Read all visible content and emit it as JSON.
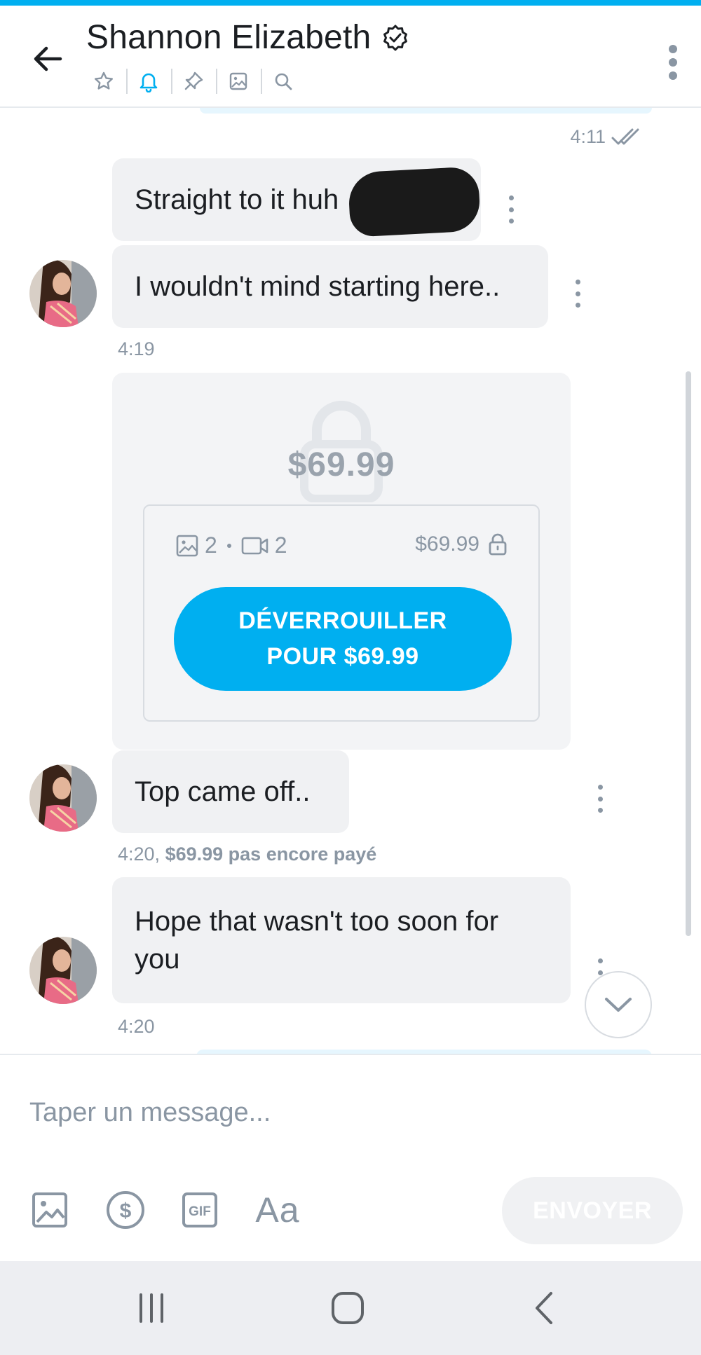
{
  "header": {
    "back_icon": "arrow-left-icon",
    "title": "Shannon Elizabeth",
    "verified_icon": "verified-badge-icon",
    "icons": [
      "star-icon",
      "bell-icon",
      "pin-icon",
      "gallery-icon",
      "search-icon"
    ],
    "active_icon": "bell-icon",
    "more_icon": "more-vertical-icon"
  },
  "messages": {
    "sent_time": "4:11",
    "m1_text": "Straight to it huh",
    "m2_text": "I wouldn't mind starting here..",
    "m2_time": "4:19",
    "locked": {
      "price_big": "$69.99",
      "photos": "2",
      "videos": "2",
      "price": "$69.99",
      "unlock_line1": "DÉVERROUILLER",
      "unlock_line2": "POUR $69.99"
    },
    "m3_text": "Top came off..",
    "m3_time": "4:20,",
    "m3_status": "$69.99 pas encore payé",
    "m4_text": "Hope that wasn't too soon for you",
    "m4_time": "4:20"
  },
  "composer": {
    "placeholder": "Taper un message...",
    "tools": [
      "image-icon",
      "dollar-icon",
      "gif-icon",
      "text-format-icon"
    ],
    "text_format_label": "Aa",
    "send_label": "ENVOYER"
  },
  "colors": {
    "accent": "#00aff0",
    "muted": "#8a96a3",
    "bubble": "#f0f1f3"
  }
}
